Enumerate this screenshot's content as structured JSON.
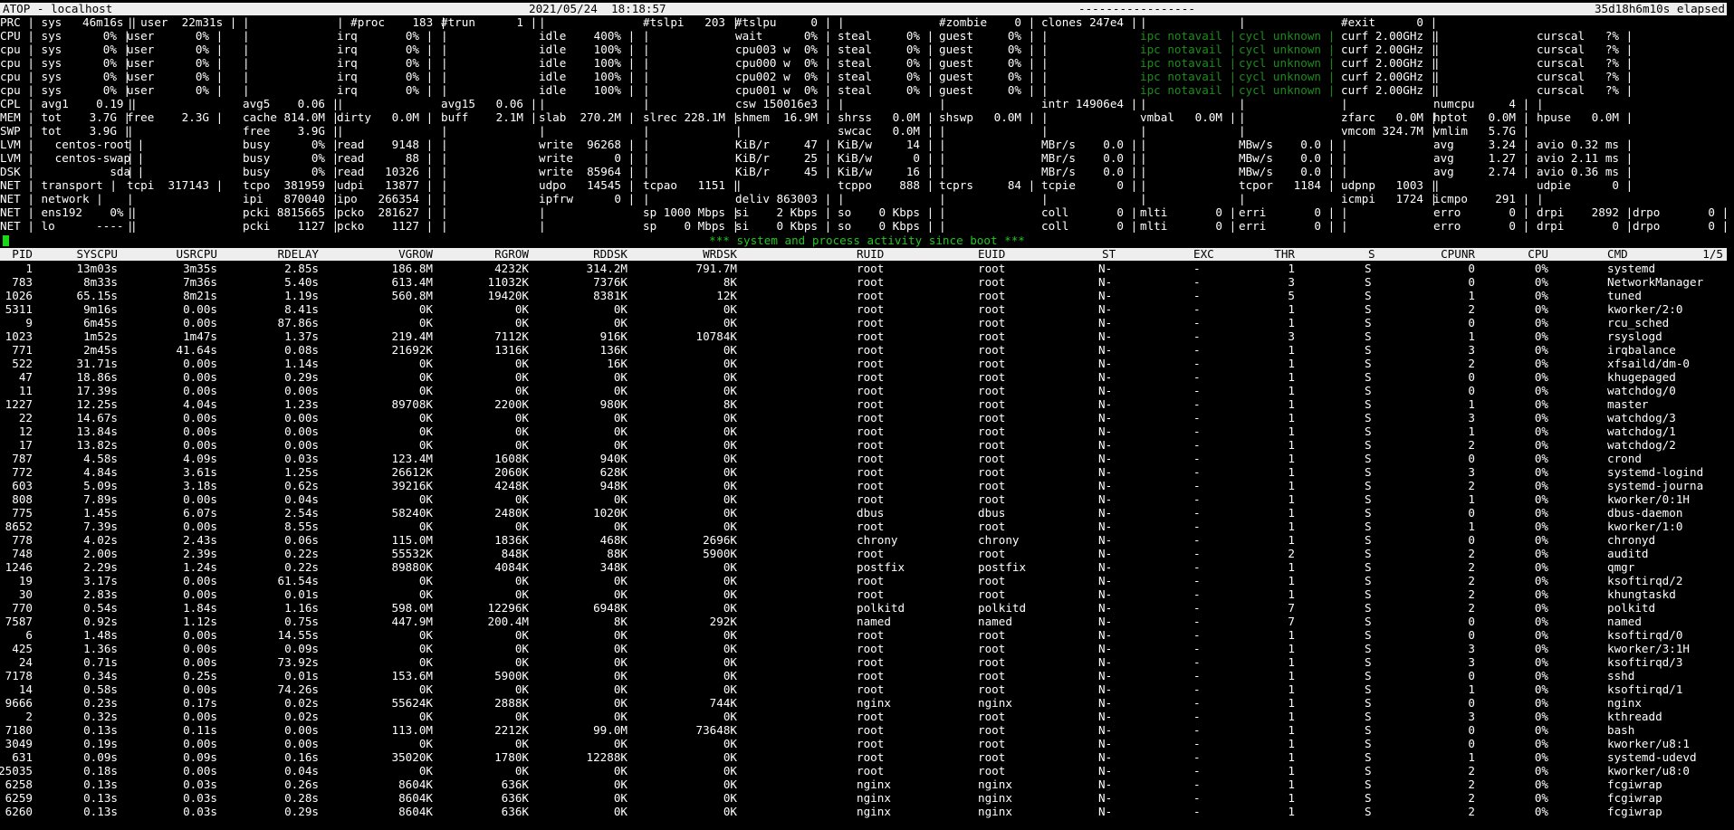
{
  "header": {
    "title": "ATOP - localhost",
    "datetime": "2021/05/24  18:18:57",
    "dashes": "-----------------",
    "elapsed": "35d18h6m10s elapsed"
  },
  "system_rows": [
    [
      "PRC | sys   46m16s |",
      "| user  22m31s |",
      "|",
      "| #proc    183 |",
      "#trun      1 |",
      "|",
      "#tslpi   203 |",
      "#tslpu     0 |",
      "|",
      "#zombie    0 |",
      "clones 247e4 |",
      "|",
      "|",
      "#exit      0 |"
    ],
    [
      "CPU | sys      0% |",
      "user      0% |",
      "|",
      "irq       0% |",
      "|",
      "idle    400% |",
      "|",
      "wait      0% |",
      "steal     0% |",
      "guest     0% |",
      "|",
      "ipc notavail |",
      "cycl unknown |",
      "curf 2.00GHz |",
      "|",
      "curscal   ?% |"
    ],
    [
      "cpu | sys      0% |",
      "user      0% |",
      "|",
      "irq       0% |",
      "|",
      "idle    100% |",
      "|",
      "cpu003 w  0% |",
      "steal     0% |",
      "guest     0% |",
      "|",
      "ipc notavail |",
      "cycl unknown |",
      "curf 2.00GHz |",
      "|",
      "curscal   ?% |"
    ],
    [
      "cpu | sys      0% |",
      "user      0% |",
      "|",
      "irq       0% |",
      "|",
      "idle    100% |",
      "|",
      "cpu000 w  0% |",
      "steal     0% |",
      "guest     0% |",
      "|",
      "ipc notavail |",
      "cycl unknown |",
      "curf 2.00GHz |",
      "|",
      "curscal   ?% |"
    ],
    [
      "cpu | sys      0% |",
      "user      0% |",
      "|",
      "irq       0% |",
      "|",
      "idle    100% |",
      "|",
      "cpu002 w  0% |",
      "steal     0% |",
      "guest     0% |",
      "|",
      "ipc notavail |",
      "cycl unknown |",
      "curf 2.00GHz |",
      "|",
      "curscal   ?% |"
    ],
    [
      "cpu | sys      0% |",
      "user      0% |",
      "|",
      "irq       0% |",
      "|",
      "idle    100% |",
      "|",
      "cpu001 w  0% |",
      "steal     0% |",
      "guest     0% |",
      "|",
      "ipc notavail |",
      "cycl unknown |",
      "curf 2.00GHz |",
      "|",
      "curscal   ?% |"
    ],
    [
      "CPL | avg1    0.19 |",
      "|",
      "avg5    0.06 |",
      "|",
      "avg15   0.06 |",
      "|",
      "|",
      "csw 150016e3 |",
      "|",
      "|",
      "intr 14906e4 |",
      "|",
      "|",
      "|",
      "numcpu     4 |",
      "|"
    ],
    [
      "MEM | tot    3.7G |",
      "free    2.3G |",
      "cache 814.0M |",
      "dirty   0.0M |",
      "buff    2.1M |",
      "slab  270.2M |",
      "slrec 228.1M |",
      "shmem  16.9M |",
      "shrss   0.0M |",
      "shswp   0.0M |",
      "|",
      "vmbal   0.0M |",
      "|",
      "zfarc   0.0M |",
      "hptot   0.0M |",
      "hpuse   0.0M |"
    ],
    [
      "SWP | tot    3.9G |",
      "|",
      "free    3.9G |",
      "|",
      "|",
      "|",
      "|",
      "|",
      "swcac   0.0M |",
      "|",
      "|",
      "|",
      "|",
      "vmcom 324.7M |",
      "vmlim   5.7G |"
    ],
    [
      "LVM |   centos-root |",
      "|",
      "busy      0% |",
      "read    9148 |",
      "|",
      "write  96268 |",
      "|",
      "KiB/r     47 |",
      "KiB/w     14 |",
      "|",
      "MBr/s    0.0 |",
      "|",
      "MBw/s    0.0 |",
      "|",
      "avg     3.24 |",
      "avio 0.32 ms |"
    ],
    [
      "LVM |   centos-swap |",
      "|",
      "busy      0% |",
      "read      88 |",
      "|",
      "write      0 |",
      "|",
      "KiB/r     25 |",
      "KiB/w      0 |",
      "|",
      "MBr/s    0.0 |",
      "|",
      "MBw/s    0.0 |",
      "|",
      "avg     1.27 |",
      "avio 2.11 ms |"
    ],
    [
      "DSK |           sda |",
      "|",
      "busy      0% |",
      "read   10326 |",
      "|",
      "write  85964 |",
      "|",
      "KiB/r     45 |",
      "KiB/w     16 |",
      "|",
      "MBr/s    0.0 |",
      "|",
      "MBw/s    0.0 |",
      "|",
      "avg     2.74 |",
      "avio 0.36 ms |"
    ],
    [
      "NET | transport |",
      "tcpi  317143 |",
      "tcpo  381959 |",
      "udpi   13877 |",
      "|",
      "udpo   14545 |",
      "tcpao   1151 |",
      "|",
      "tcppo    888 |",
      "tcprs     84 |",
      "tcpie      0 |",
      "|",
      "tcpor   1184 |",
      "udpnp   1003 |",
      "|",
      "udpie      0 |"
    ],
    [
      "NET | network |",
      "|",
      "ipi   870040 |",
      "ipo   266354 |",
      "|",
      "ipfrw      0 |",
      "|",
      "deliv 863003 |",
      "|",
      "|",
      "|",
      "|",
      "|",
      "icmpi   1724 |",
      "icmpo    291 |",
      "|"
    ],
    [
      "NET | ens192    0% |",
      "|",
      "pcki 8815665 |",
      "pcko  281627 |",
      "|",
      "|",
      "sp 1000 Mbps |",
      "si    2 Kbps |",
      "so    0 Kbps |",
      "|",
      "coll       0 |",
      "mlti       0 |",
      "erri       0 |",
      "|",
      "erro       0 |",
      "drpi    2892 |",
      "drpo       0 |"
    ],
    [
      "NET | lo      ---- |",
      "|",
      "pcki    1127 |",
      "pcko    1127 |",
      "|",
      "|",
      "sp    0 Mbps |",
      "si    0 Kbps |",
      "so    0 Kbps |",
      "|",
      "coll       0 |",
      "mlti       0 |",
      "erri       0 |",
      "|",
      "erro       0 |",
      "drpi       0 |",
      "drpo       0 |"
    ]
  ],
  "banner": "*** system and process activity since boot ***",
  "columns": [
    "PID",
    "SYSCPU",
    "USRCPU",
    "RDELAY",
    "VGROW",
    "RGROW",
    "RDDSK",
    "WRDSK",
    "RUID",
    "EUID",
    "ST",
    "EXC",
    "THR",
    "S",
    "CPUNR",
    "CPU",
    "CMD",
    "1/5"
  ],
  "processes": [
    [
      "1",
      "13m03s",
      "3m35s",
      "2.85s",
      "186.8M",
      "4232K",
      "314.2M",
      "791.7M",
      "root",
      "root",
      "N-",
      "-",
      "1",
      "S",
      "0",
      "0%",
      "systemd"
    ],
    [
      "783",
      "8m33s",
      "7m36s",
      "5.40s",
      "613.4M",
      "11032K",
      "7376K",
      "8K",
      "root",
      "root",
      "N-",
      "-",
      "3",
      "S",
      "0",
      "0%",
      "NetworkManager"
    ],
    [
      "1026",
      "65.15s",
      "8m21s",
      "1.19s",
      "560.8M",
      "19420K",
      "8381K",
      "12K",
      "root",
      "root",
      "N-",
      "-",
      "5",
      "S",
      "1",
      "0%",
      "tuned"
    ],
    [
      "5311",
      "9m16s",
      "0.00s",
      "8.41s",
      "0K",
      "0K",
      "0K",
      "0K",
      "root",
      "root",
      "N-",
      "-",
      "1",
      "S",
      "2",
      "0%",
      "kworker/2:0"
    ],
    [
      "9",
      "6m45s",
      "0.00s",
      "87.86s",
      "0K",
      "0K",
      "0K",
      "0K",
      "root",
      "root",
      "N-",
      "-",
      "1",
      "S",
      "0",
      "0%",
      "rcu_sched"
    ],
    [
      "1023",
      "1m52s",
      "1m47s",
      "1.37s",
      "219.4M",
      "7112K",
      "916K",
      "10784K",
      "root",
      "root",
      "N-",
      "-",
      "3",
      "S",
      "1",
      "0%",
      "rsyslogd"
    ],
    [
      "771",
      "2m45s",
      "41.64s",
      "0.08s",
      "21692K",
      "1316K",
      "136K",
      "0K",
      "root",
      "root",
      "N-",
      "-",
      "1",
      "S",
      "3",
      "0%",
      "irqbalance"
    ],
    [
      "522",
      "31.71s",
      "0.00s",
      "1.14s",
      "0K",
      "0K",
      "16K",
      "0K",
      "root",
      "root",
      "N-",
      "-",
      "1",
      "S",
      "2",
      "0%",
      "xfsaild/dm-0"
    ],
    [
      "47",
      "18.86s",
      "0.00s",
      "0.29s",
      "0K",
      "0K",
      "0K",
      "0K",
      "root",
      "root",
      "N-",
      "-",
      "1",
      "S",
      "0",
      "0%",
      "khugepaged"
    ],
    [
      "11",
      "17.39s",
      "0.00s",
      "0.00s",
      "0K",
      "0K",
      "0K",
      "0K",
      "root",
      "root",
      "N-",
      "-",
      "1",
      "S",
      "0",
      "0%",
      "watchdog/0"
    ],
    [
      "1227",
      "12.25s",
      "4.04s",
      "1.23s",
      "89708K",
      "2200K",
      "980K",
      "8K",
      "root",
      "root",
      "N-",
      "-",
      "1",
      "S",
      "1",
      "0%",
      "master"
    ],
    [
      "22",
      "14.67s",
      "0.00s",
      "0.00s",
      "0K",
      "0K",
      "0K",
      "0K",
      "root",
      "root",
      "N-",
      "-",
      "1",
      "S",
      "3",
      "0%",
      "watchdog/3"
    ],
    [
      "12",
      "13.84s",
      "0.00s",
      "0.00s",
      "0K",
      "0K",
      "0K",
      "0K",
      "root",
      "root",
      "N-",
      "-",
      "1",
      "S",
      "1",
      "0%",
      "watchdog/1"
    ],
    [
      "17",
      "13.82s",
      "0.00s",
      "0.00s",
      "0K",
      "0K",
      "0K",
      "0K",
      "root",
      "root",
      "N-",
      "-",
      "1",
      "S",
      "2",
      "0%",
      "watchdog/2"
    ],
    [
      "787",
      "4.58s",
      "4.09s",
      "0.03s",
      "123.4M",
      "1608K",
      "940K",
      "0K",
      "root",
      "root",
      "N-",
      "-",
      "1",
      "S",
      "0",
      "0%",
      "crond"
    ],
    [
      "772",
      "4.84s",
      "3.61s",
      "1.25s",
      "26612K",
      "2060K",
      "628K",
      "0K",
      "root",
      "root",
      "N-",
      "-",
      "1",
      "S",
      "3",
      "0%",
      "systemd-logind"
    ],
    [
      "603",
      "5.09s",
      "3.18s",
      "0.62s",
      "39216K",
      "4248K",
      "948K",
      "0K",
      "root",
      "root",
      "N-",
      "-",
      "1",
      "S",
      "2",
      "0%",
      "systemd-journa"
    ],
    [
      "808",
      "7.89s",
      "0.00s",
      "0.04s",
      "0K",
      "0K",
      "0K",
      "0K",
      "root",
      "root",
      "N-",
      "-",
      "1",
      "S",
      "1",
      "0%",
      "kworker/0:1H"
    ],
    [
      "775",
      "1.45s",
      "6.07s",
      "2.54s",
      "58240K",
      "2480K",
      "1020K",
      "0K",
      "dbus",
      "dbus",
      "N-",
      "-",
      "1",
      "S",
      "0",
      "0%",
      "dbus-daemon"
    ],
    [
      "8652",
      "7.39s",
      "0.00s",
      "8.55s",
      "0K",
      "0K",
      "0K",
      "0K",
      "root",
      "root",
      "N-",
      "-",
      "1",
      "S",
      "1",
      "0%",
      "kworker/1:0"
    ],
    [
      "778",
      "4.02s",
      "2.43s",
      "0.06s",
      "115.0M",
      "1836K",
      "468K",
      "2696K",
      "chrony",
      "chrony",
      "N-",
      "-",
      "1",
      "S",
      "0",
      "0%",
      "chronyd"
    ],
    [
      "748",
      "2.00s",
      "2.39s",
      "0.22s",
      "55532K",
      "848K",
      "88K",
      "5900K",
      "root",
      "root",
      "N-",
      "-",
      "2",
      "S",
      "2",
      "0%",
      "auditd"
    ],
    [
      "1246",
      "2.29s",
      "1.24s",
      "0.22s",
      "89880K",
      "4084K",
      "348K",
      "0K",
      "postfix",
      "postfix",
      "N-",
      "-",
      "1",
      "S",
      "2",
      "0%",
      "qmgr"
    ],
    [
      "19",
      "3.17s",
      "0.00s",
      "61.54s",
      "0K",
      "0K",
      "0K",
      "0K",
      "root",
      "root",
      "N-",
      "-",
      "1",
      "S",
      "2",
      "0%",
      "ksoftirqd/2"
    ],
    [
      "30",
      "2.83s",
      "0.00s",
      "0.01s",
      "0K",
      "0K",
      "0K",
      "0K",
      "root",
      "root",
      "N-",
      "-",
      "1",
      "S",
      "2",
      "0%",
      "khungtaskd"
    ],
    [
      "770",
      "0.54s",
      "1.84s",
      "1.16s",
      "598.0M",
      "12296K",
      "6948K",
      "0K",
      "polkitd",
      "polkitd",
      "N-",
      "-",
      "7",
      "S",
      "2",
      "0%",
      "polkitd"
    ],
    [
      "7587",
      "0.92s",
      "1.12s",
      "0.75s",
      "447.9M",
      "200.4M",
      "8K",
      "292K",
      "named",
      "named",
      "N-",
      "-",
      "7",
      "S",
      "0",
      "0%",
      "named"
    ],
    [
      "6",
      "1.48s",
      "0.00s",
      "14.55s",
      "0K",
      "0K",
      "0K",
      "0K",
      "root",
      "root",
      "N-",
      "-",
      "1",
      "S",
      "0",
      "0%",
      "ksoftirqd/0"
    ],
    [
      "425",
      "1.36s",
      "0.00s",
      "0.09s",
      "0K",
      "0K",
      "0K",
      "0K",
      "root",
      "root",
      "N-",
      "-",
      "1",
      "S",
      "3",
      "0%",
      "kworker/3:1H"
    ],
    [
      "24",
      "0.71s",
      "0.00s",
      "73.92s",
      "0K",
      "0K",
      "0K",
      "0K",
      "root",
      "root",
      "N-",
      "-",
      "1",
      "S",
      "3",
      "0%",
      "ksoftirqd/3"
    ],
    [
      "7178",
      "0.34s",
      "0.25s",
      "0.01s",
      "153.6M",
      "5900K",
      "0K",
      "0K",
      "root",
      "root",
      "N-",
      "-",
      "1",
      "S",
      "0",
      "0%",
      "sshd"
    ],
    [
      "14",
      "0.58s",
      "0.00s",
      "74.26s",
      "0K",
      "0K",
      "0K",
      "0K",
      "root",
      "root",
      "N-",
      "-",
      "1",
      "S",
      "1",
      "0%",
      "ksoftirqd/1"
    ],
    [
      "9666",
      "0.23s",
      "0.17s",
      "0.02s",
      "55624K",
      "2888K",
      "0K",
      "744K",
      "nginx",
      "nginx",
      "N-",
      "-",
      "1",
      "S",
      "0",
      "0%",
      "nginx"
    ],
    [
      "2",
      "0.32s",
      "0.00s",
      "0.02s",
      "0K",
      "0K",
      "0K",
      "0K",
      "root",
      "root",
      "N-",
      "-",
      "1",
      "S",
      "3",
      "0%",
      "kthreadd"
    ],
    [
      "7180",
      "0.13s",
      "0.11s",
      "0.00s",
      "113.0M",
      "2212K",
      "99.0M",
      "73648K",
      "root",
      "root",
      "N-",
      "-",
      "1",
      "S",
      "0",
      "0%",
      "bash"
    ],
    [
      "3049",
      "0.19s",
      "0.00s",
      "0.00s",
      "0K",
      "0K",
      "0K",
      "0K",
      "root",
      "root",
      "N-",
      "-",
      "1",
      "S",
      "0",
      "0%",
      "kworker/u8:1"
    ],
    [
      "631",
      "0.09s",
      "0.09s",
      "0.16s",
      "35020K",
      "1780K",
      "12288K",
      "0K",
      "root",
      "root",
      "N-",
      "-",
      "1",
      "S",
      "1",
      "0%",
      "systemd-udevd"
    ],
    [
      "25035",
      "0.18s",
      "0.00s",
      "0.04s",
      "0K",
      "0K",
      "0K",
      "0K",
      "root",
      "root",
      "N-",
      "-",
      "1",
      "S",
      "2",
      "0%",
      "kworker/u8:0"
    ],
    [
      "6258",
      "0.13s",
      "0.03s",
      "0.26s",
      "8604K",
      "636K",
      "0K",
      "0K",
      "nginx",
      "nginx",
      "N-",
      "-",
      "1",
      "S",
      "2",
      "0%",
      "fcgiwrap"
    ],
    [
      "6259",
      "0.13s",
      "0.03s",
      "0.28s",
      "8604K",
      "636K",
      "0K",
      "0K",
      "nginx",
      "nginx",
      "N-",
      "-",
      "1",
      "S",
      "2",
      "0%",
      "fcgiwrap"
    ],
    [
      "6260",
      "0.13s",
      "0.03s",
      "0.29s",
      "8604K",
      "636K",
      "0K",
      "0K",
      "nginx",
      "nginx",
      "N-",
      "-",
      "1",
      "S",
      "2",
      "0%",
      "fcgiwrap"
    ]
  ],
  "colors": {
    "bar_bg": "#eeeeee",
    "dim_green": "#1c8c1c",
    "banner_green": "#23c423",
    "cursor_green": "#17d817"
  }
}
